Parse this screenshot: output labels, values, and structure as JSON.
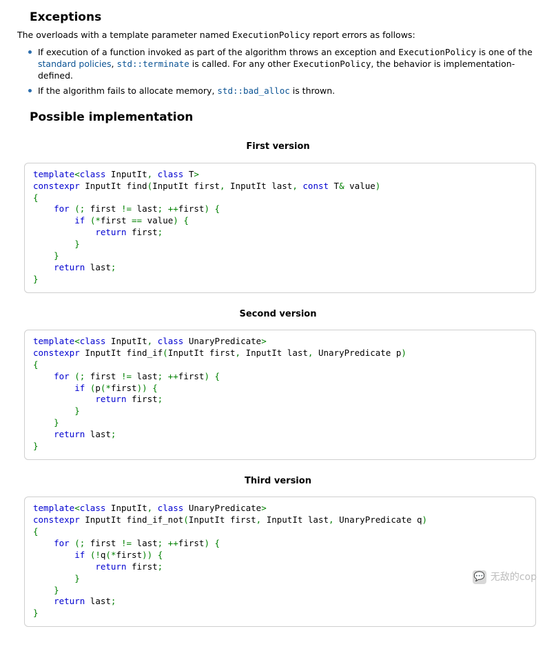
{
  "headings": {
    "exceptions": "Exceptions",
    "implementation": "Possible implementation"
  },
  "intro": {
    "prefix": "The overloads with a template parameter named ",
    "code": "ExecutionPolicy",
    "suffix": " report errors as follows:"
  },
  "bullets": [
    {
      "p1": "If execution of a function invoked as part of the algorithm throws an exception and ",
      "c1": "ExecutionPolicy",
      "p2": " is one of the ",
      "link1": "standard policies",
      "p3": ", ",
      "link2": "std::terminate",
      "p4": " is called. For any other ",
      "c2": "ExecutionPolicy",
      "p5": ", the behavior is implementation-defined."
    },
    {
      "p1": "If the algorithm fails to allocate memory, ",
      "link1": "std::bad_alloc",
      "p2": " is thrown."
    }
  ],
  "versions": [
    {
      "title": "First version",
      "tokens": [
        [
          "kw",
          "template"
        ],
        [
          "pn",
          "<"
        ],
        [
          "kw",
          "class"
        ],
        [
          "pl",
          " InputIt"
        ],
        [
          "pn",
          ", "
        ],
        [
          "kw",
          "class"
        ],
        [
          "pl",
          " T"
        ],
        [
          "pn",
          ">"
        ],
        [
          "nl",
          ""
        ],
        [
          "kw",
          "constexpr"
        ],
        [
          "pl",
          " InputIt find"
        ],
        [
          "pn",
          "("
        ],
        [
          "pl",
          "InputIt first"
        ],
        [
          "pn",
          ", "
        ],
        [
          "pl",
          "InputIt last"
        ],
        [
          "pn",
          ", "
        ],
        [
          "kw",
          "const"
        ],
        [
          "pl",
          " T"
        ],
        [
          "pn",
          "&"
        ],
        [
          "pl",
          " value"
        ],
        [
          "pn",
          ")"
        ],
        [
          "nl",
          ""
        ],
        [
          "pn",
          "{"
        ],
        [
          "nl",
          ""
        ],
        [
          "pl",
          "    "
        ],
        [
          "kw",
          "for"
        ],
        [
          "pl",
          " "
        ],
        [
          "pn",
          "("
        ],
        [
          "pn",
          ";"
        ],
        [
          "pl",
          " first "
        ],
        [
          "pn",
          "!="
        ],
        [
          "pl",
          " last"
        ],
        [
          "pn",
          ";"
        ],
        [
          "pl",
          " "
        ],
        [
          "pn",
          "++"
        ],
        [
          "pl",
          "first"
        ],
        [
          "pn",
          ")"
        ],
        [
          "pl",
          " "
        ],
        [
          "pn",
          "{"
        ],
        [
          "nl",
          ""
        ],
        [
          "pl",
          "        "
        ],
        [
          "kw",
          "if"
        ],
        [
          "pl",
          " "
        ],
        [
          "pn",
          "("
        ],
        [
          "pn",
          "*"
        ],
        [
          "pl",
          "first "
        ],
        [
          "pn",
          "=="
        ],
        [
          "pl",
          " value"
        ],
        [
          "pn",
          ")"
        ],
        [
          "pl",
          " "
        ],
        [
          "pn",
          "{"
        ],
        [
          "nl",
          ""
        ],
        [
          "pl",
          "            "
        ],
        [
          "kw",
          "return"
        ],
        [
          "pl",
          " first"
        ],
        [
          "pn",
          ";"
        ],
        [
          "nl",
          ""
        ],
        [
          "pl",
          "        "
        ],
        [
          "pn",
          "}"
        ],
        [
          "nl",
          ""
        ],
        [
          "pl",
          "    "
        ],
        [
          "pn",
          "}"
        ],
        [
          "nl",
          ""
        ],
        [
          "pl",
          "    "
        ],
        [
          "kw",
          "return"
        ],
        [
          "pl",
          " last"
        ],
        [
          "pn",
          ";"
        ],
        [
          "nl",
          ""
        ],
        [
          "pn",
          "}"
        ]
      ]
    },
    {
      "title": "Second version",
      "tokens": [
        [
          "kw",
          "template"
        ],
        [
          "pn",
          "<"
        ],
        [
          "kw",
          "class"
        ],
        [
          "pl",
          " InputIt"
        ],
        [
          "pn",
          ", "
        ],
        [
          "kw",
          "class"
        ],
        [
          "pl",
          " UnaryPredicate"
        ],
        [
          "pn",
          ">"
        ],
        [
          "nl",
          ""
        ],
        [
          "kw",
          "constexpr"
        ],
        [
          "pl",
          " InputIt find_if"
        ],
        [
          "pn",
          "("
        ],
        [
          "pl",
          "InputIt first"
        ],
        [
          "pn",
          ", "
        ],
        [
          "pl",
          "InputIt last"
        ],
        [
          "pn",
          ", "
        ],
        [
          "pl",
          "UnaryPredicate p"
        ],
        [
          "pn",
          ")"
        ],
        [
          "nl",
          ""
        ],
        [
          "pn",
          "{"
        ],
        [
          "nl",
          ""
        ],
        [
          "pl",
          "    "
        ],
        [
          "kw",
          "for"
        ],
        [
          "pl",
          " "
        ],
        [
          "pn",
          "("
        ],
        [
          "pn",
          ";"
        ],
        [
          "pl",
          " first "
        ],
        [
          "pn",
          "!="
        ],
        [
          "pl",
          " last"
        ],
        [
          "pn",
          ";"
        ],
        [
          "pl",
          " "
        ],
        [
          "pn",
          "++"
        ],
        [
          "pl",
          "first"
        ],
        [
          "pn",
          ")"
        ],
        [
          "pl",
          " "
        ],
        [
          "pn",
          "{"
        ],
        [
          "nl",
          ""
        ],
        [
          "pl",
          "        "
        ],
        [
          "kw",
          "if"
        ],
        [
          "pl",
          " "
        ],
        [
          "pn",
          "("
        ],
        [
          "pl",
          "p"
        ],
        [
          "pn",
          "("
        ],
        [
          "pn",
          "*"
        ],
        [
          "pl",
          "first"
        ],
        [
          "pn",
          ")"
        ],
        [
          "pn",
          ")"
        ],
        [
          "pl",
          " "
        ],
        [
          "pn",
          "{"
        ],
        [
          "nl",
          ""
        ],
        [
          "pl",
          "            "
        ],
        [
          "kw",
          "return"
        ],
        [
          "pl",
          " first"
        ],
        [
          "pn",
          ";"
        ],
        [
          "nl",
          ""
        ],
        [
          "pl",
          "        "
        ],
        [
          "pn",
          "}"
        ],
        [
          "nl",
          ""
        ],
        [
          "pl",
          "    "
        ],
        [
          "pn",
          "}"
        ],
        [
          "nl",
          ""
        ],
        [
          "pl",
          "    "
        ],
        [
          "kw",
          "return"
        ],
        [
          "pl",
          " last"
        ],
        [
          "pn",
          ";"
        ],
        [
          "nl",
          ""
        ],
        [
          "pn",
          "}"
        ]
      ]
    },
    {
      "title": "Third version",
      "tokens": [
        [
          "kw",
          "template"
        ],
        [
          "pn",
          "<"
        ],
        [
          "kw",
          "class"
        ],
        [
          "pl",
          " InputIt"
        ],
        [
          "pn",
          ", "
        ],
        [
          "kw",
          "class"
        ],
        [
          "pl",
          " UnaryPredicate"
        ],
        [
          "pn",
          ">"
        ],
        [
          "nl",
          ""
        ],
        [
          "kw",
          "constexpr"
        ],
        [
          "pl",
          " InputIt find_if_not"
        ],
        [
          "pn",
          "("
        ],
        [
          "pl",
          "InputIt first"
        ],
        [
          "pn",
          ", "
        ],
        [
          "pl",
          "InputIt last"
        ],
        [
          "pn",
          ", "
        ],
        [
          "pl",
          "UnaryPredicate q"
        ],
        [
          "pn",
          ")"
        ],
        [
          "nl",
          ""
        ],
        [
          "pn",
          "{"
        ],
        [
          "nl",
          ""
        ],
        [
          "pl",
          "    "
        ],
        [
          "kw",
          "for"
        ],
        [
          "pl",
          " "
        ],
        [
          "pn",
          "("
        ],
        [
          "pn",
          ";"
        ],
        [
          "pl",
          " first "
        ],
        [
          "pn",
          "!="
        ],
        [
          "pl",
          " last"
        ],
        [
          "pn",
          ";"
        ],
        [
          "pl",
          " "
        ],
        [
          "pn",
          "++"
        ],
        [
          "pl",
          "first"
        ],
        [
          "pn",
          ")"
        ],
        [
          "pl",
          " "
        ],
        [
          "pn",
          "{"
        ],
        [
          "nl",
          ""
        ],
        [
          "pl",
          "        "
        ],
        [
          "kw",
          "if"
        ],
        [
          "pl",
          " "
        ],
        [
          "pn",
          "("
        ],
        [
          "pn",
          "!"
        ],
        [
          "pl",
          "q"
        ],
        [
          "pn",
          "("
        ],
        [
          "pn",
          "*"
        ],
        [
          "pl",
          "first"
        ],
        [
          "pn",
          ")"
        ],
        [
          "pn",
          ")"
        ],
        [
          "pl",
          " "
        ],
        [
          "pn",
          "{"
        ],
        [
          "nl",
          ""
        ],
        [
          "pl",
          "            "
        ],
        [
          "kw",
          "return"
        ],
        [
          "pl",
          " first"
        ],
        [
          "pn",
          ";"
        ],
        [
          "nl",
          ""
        ],
        [
          "pl",
          "        "
        ],
        [
          "pn",
          "}"
        ],
        [
          "nl",
          ""
        ],
        [
          "pl",
          "    "
        ],
        [
          "pn",
          "}"
        ],
        [
          "nl",
          ""
        ],
        [
          "pl",
          "    "
        ],
        [
          "kw",
          "return"
        ],
        [
          "pl",
          " last"
        ],
        [
          "pn",
          ";"
        ],
        [
          "nl",
          ""
        ],
        [
          "pn",
          "}"
        ]
      ]
    }
  ],
  "watermark": {
    "icon": "💬",
    "text": "无敌的cop"
  }
}
